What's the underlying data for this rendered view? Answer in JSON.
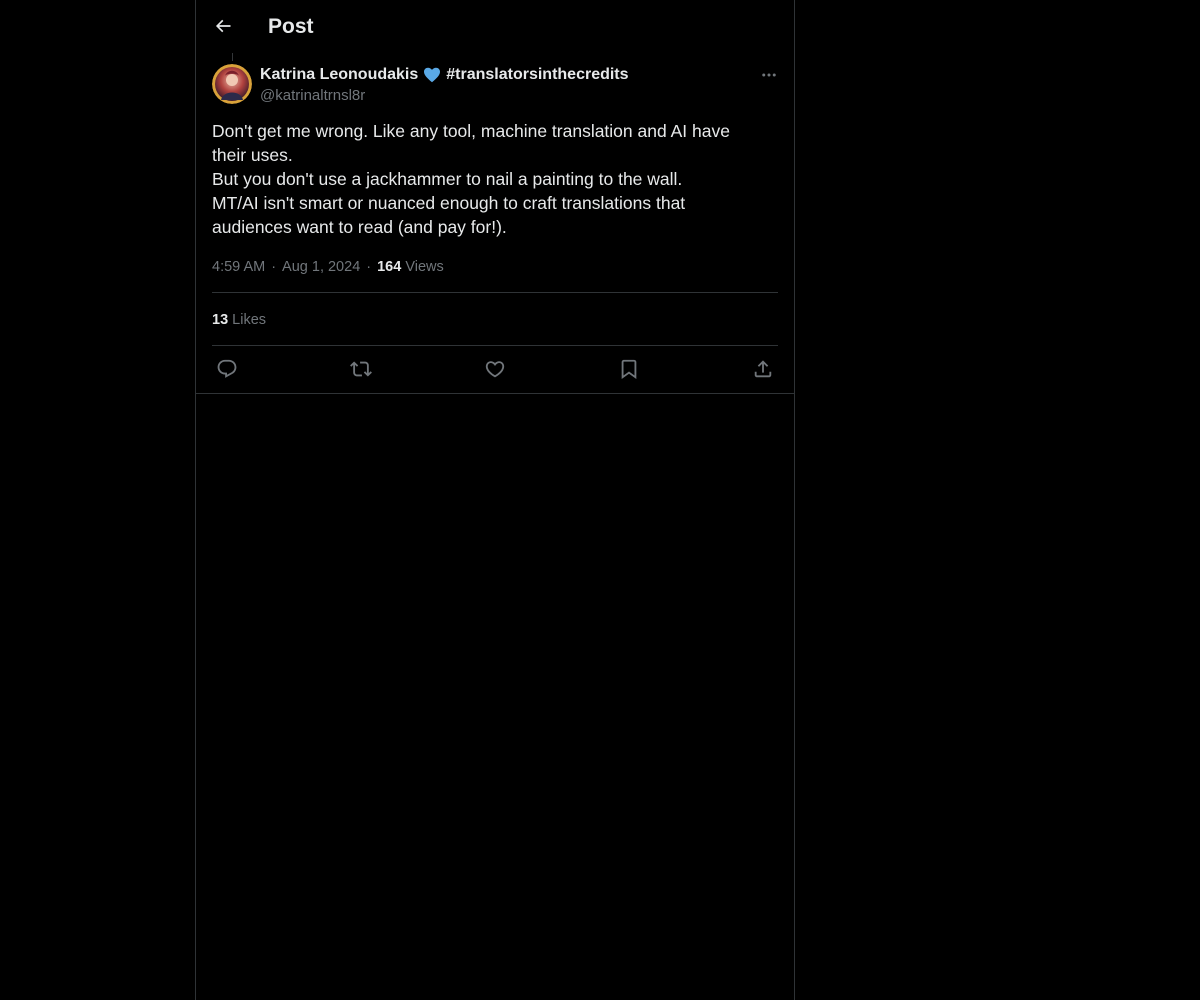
{
  "header": {
    "title": "Post",
    "back_icon": "arrow-left-icon"
  },
  "author": {
    "name": "Katrina Leonoudakis",
    "emoji": "blue-heart",
    "hashtag": "#translatorsinthecredits",
    "handle": "@katrinaltrnsl8r"
  },
  "post": {
    "lines": [
      "Don't get me wrong. Like any tool, machine translation and AI have",
      "their uses.",
      "But you don't use a jackhammer to nail a painting to the wall.",
      "MT/AI isn't smart or nuanced enough to craft translations that",
      "audiences want to read (and pay for!)."
    ],
    "time": "4:59 AM",
    "date": "Aug 1, 2024",
    "views_count": "164",
    "views_label": "Views",
    "likes_count": "13",
    "likes_label": "Likes"
  },
  "actions": [
    "reply-icon",
    "repost-icon",
    "like-icon",
    "bookmark-icon",
    "share-icon"
  ],
  "colors": {
    "background": "#000000",
    "text_primary": "#e7e9ea",
    "text_secondary": "#71767b",
    "border": "#2f3336",
    "heart": "#5aa9e6"
  }
}
